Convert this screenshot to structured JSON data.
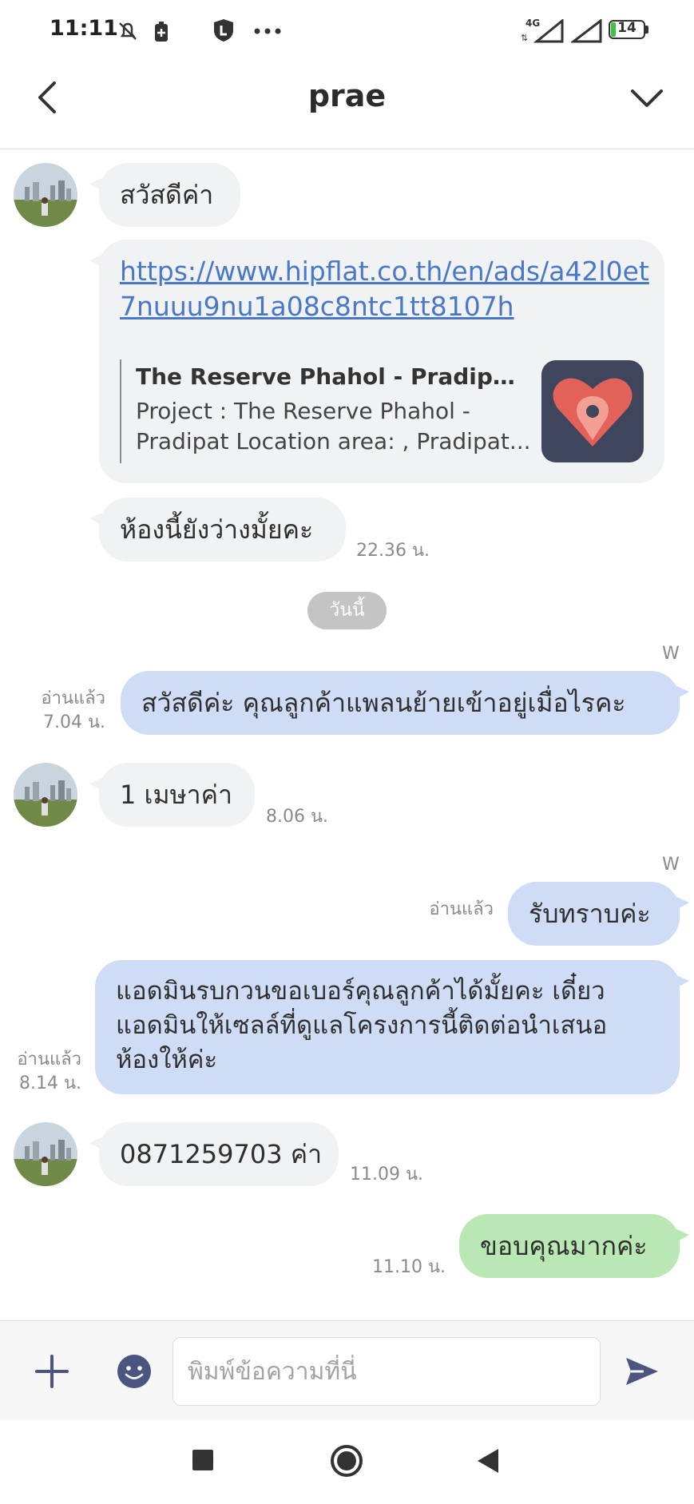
{
  "status_bar": {
    "time": "11:11",
    "network": "4G",
    "battery": "14"
  },
  "header": {
    "title": "prae"
  },
  "messages": {
    "m1": {
      "text": "สวัสดีค่า"
    },
    "m2": {
      "link": "https://www.hipflat.co.th/en/ads/a42l0et7nuuu9nu1a08c8ntc1tt8107h",
      "link_line1": "https://www.hipflat.co.th/en/ads/a42l0et",
      "link_line2": "7nuuu9nu1a08c8ntc1tt8107h",
      "preview_title": "The Reserve Phahol - Pradipat - ...",
      "preview_desc_line1": "Project : The Reserve Phahol -",
      "preview_desc_line2": "Pradipat Location area: , Pradipat..."
    },
    "m3": {
      "text": "ห้องนี้ยังว่างมั้ยคะ",
      "time": "22.36 น."
    },
    "date_divider": "วันนี้",
    "m4": {
      "sender_tag": "W",
      "read": "อ่านแล้ว",
      "time": "7.04 น.",
      "text": "สวัสดีค่ะ คุณลูกค้าแพลนย้ายเข้าอยู่เมื่อไรคะ"
    },
    "m5": {
      "text": "1 เมษาค่า",
      "time": "8.06 น."
    },
    "m6": {
      "sender_tag": "W",
      "read": "อ่านแล้ว",
      "text": "รับทราบค่ะ"
    },
    "m7": {
      "read": "อ่านแล้ว",
      "time": "8.14 น.",
      "line1": "แอดมินรบกวนขอเบอร์คุณลูกค้าได้มั้ยคะ เดี๋ยว",
      "line2": "แอดมินให้เซลล์ที่ดูแลโครงการนี้ติดต่อนำเสนอ",
      "line3": "ห้องให้ค่ะ"
    },
    "m8": {
      "text": "0871259703 ค่า",
      "time": "11.09 น."
    },
    "m9": {
      "text": "ขอบคุณมากค่ะ",
      "time": "11.10 น."
    }
  },
  "input": {
    "placeholder": "พิมพ์ข้อความที่นี่"
  },
  "colors": {
    "outgoing": "#cfdcf6",
    "incoming": "#f1f2f4",
    "sent_pending": "#b9e8b5",
    "link": "#4a78c8",
    "accent": "#4c5580"
  }
}
